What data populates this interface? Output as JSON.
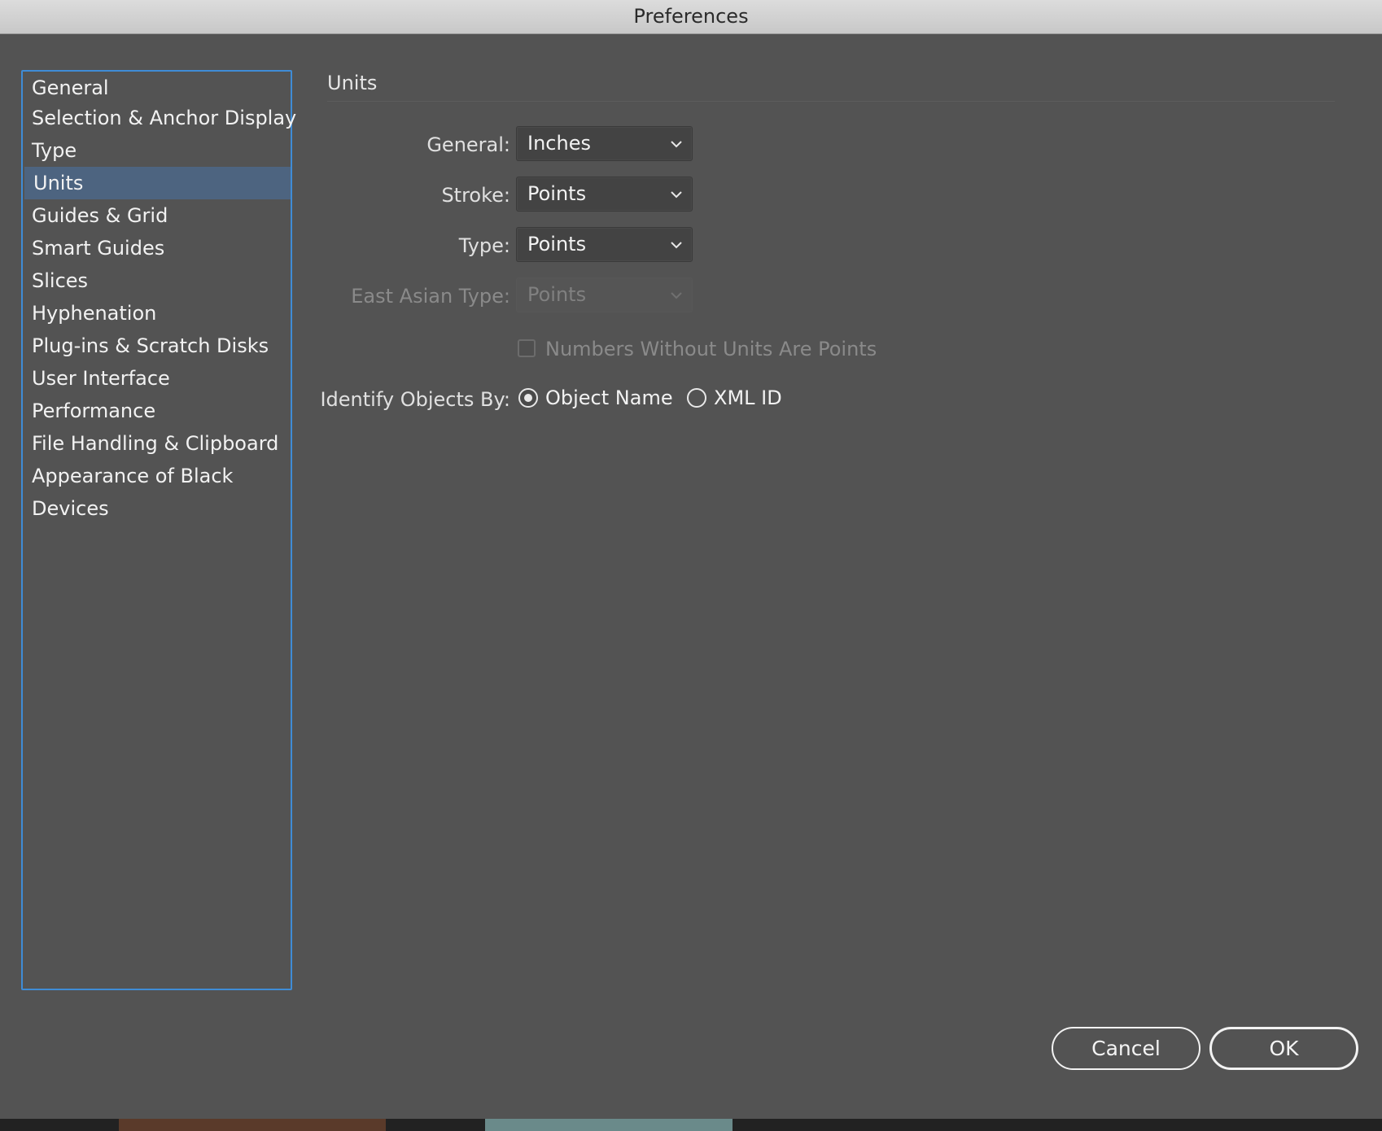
{
  "window": {
    "title": "Preferences"
  },
  "sidebar": {
    "items": [
      {
        "label": "General"
      },
      {
        "label": "Selection & Anchor Display"
      },
      {
        "label": "Type"
      },
      {
        "label": "Units"
      },
      {
        "label": "Guides & Grid"
      },
      {
        "label": "Smart Guides"
      },
      {
        "label": "Slices"
      },
      {
        "label": "Hyphenation"
      },
      {
        "label": "Plug-ins & Scratch Disks"
      },
      {
        "label": "User Interface"
      },
      {
        "label": "Performance"
      },
      {
        "label": "File Handling & Clipboard"
      },
      {
        "label": "Appearance of Black"
      },
      {
        "label": "Devices"
      }
    ],
    "selected": "Units"
  },
  "panel": {
    "header": "Units",
    "general": {
      "label": "General:",
      "value": "Inches"
    },
    "stroke": {
      "label": "Stroke:",
      "value": "Points"
    },
    "type": {
      "label": "Type:",
      "value": "Points"
    },
    "east_asian_type": {
      "label": "East Asian Type:",
      "value": "Points",
      "enabled": false
    },
    "numbers_without_units": {
      "label": "Numbers Without Units Are Points",
      "checked": false,
      "enabled": false
    },
    "identify_objects": {
      "label": "Identify Objects By:",
      "options": [
        {
          "label": "Object Name",
          "selected": true
        },
        {
          "label": "XML ID",
          "selected": false
        }
      ]
    }
  },
  "buttons": {
    "cancel": "Cancel",
    "ok": "OK"
  },
  "colors": {
    "dialog_bg": "#535353",
    "selection": "#4d6480",
    "focus_ring": "#3f8cd6"
  }
}
